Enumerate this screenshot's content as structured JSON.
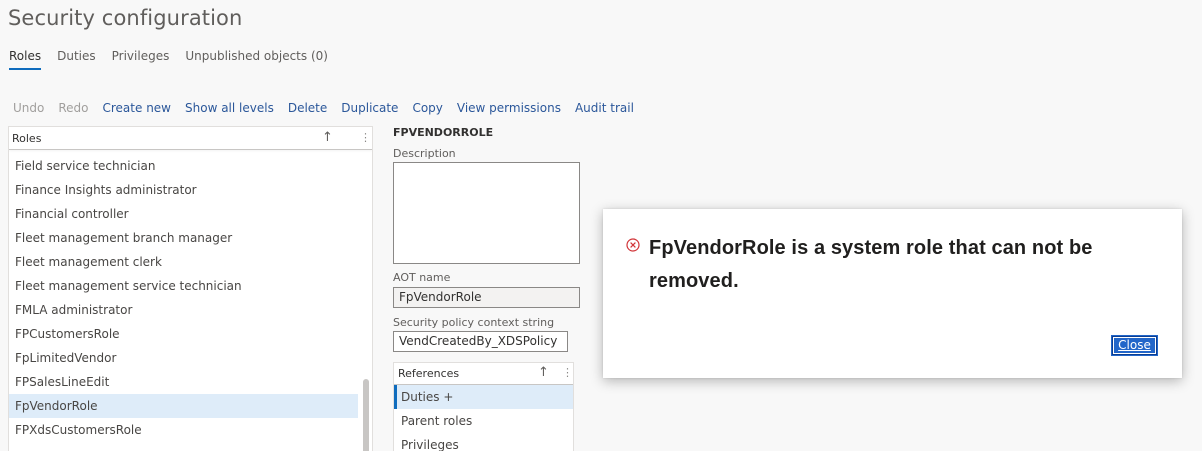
{
  "page": {
    "title": "Security configuration"
  },
  "tabs": [
    {
      "label": "Roles",
      "active": true
    },
    {
      "label": "Duties"
    },
    {
      "label": "Privileges"
    },
    {
      "label": "Unpublished objects (0)"
    }
  ],
  "toolbar": {
    "undo": "Undo",
    "redo": "Redo",
    "create_new": "Create new",
    "show_all_levels": "Show all levels",
    "delete": "Delete",
    "duplicate": "Duplicate",
    "copy": "Copy",
    "view_permissions": "View permissions",
    "audit_trail": "Audit trail"
  },
  "roles_list": {
    "header": "Roles",
    "sort_icon": "arrow-up-icon",
    "more_icon": "vertical-ellipsis-icon",
    "items": [
      "Field service technician",
      "Finance Insights administrator",
      "Financial controller",
      "Fleet management branch manager",
      "Fleet management clerk",
      "Fleet management service technician",
      "FMLA administrator",
      "FPCustomersRole",
      "FpLimitedVendor",
      "FPSalesLineEdit",
      "FpVendorRole",
      "FPXdsCustomersRole"
    ],
    "selected": "FpVendorRole"
  },
  "detail": {
    "header": "FPVENDORROLE",
    "description_label": "Description",
    "description_value": "",
    "aot_label": "AOT name",
    "aot_value": "FpVendorRole",
    "policy_label": "Security policy context string",
    "policy_value": "VendCreatedBy_XDSPolicy"
  },
  "references": {
    "header": "References",
    "items": [
      "Duties +",
      "Parent roles",
      "Privileges"
    ],
    "selected": "Duties +"
  },
  "dialog": {
    "icon": "error-circle-icon",
    "message": "FpVendorRole is a system role that can not be removed.",
    "close_label": "Close"
  },
  "colors": {
    "accent": "#0f6cbd",
    "link": "#2b579a",
    "error": "#d13438",
    "selected_row": "#deecf9"
  }
}
